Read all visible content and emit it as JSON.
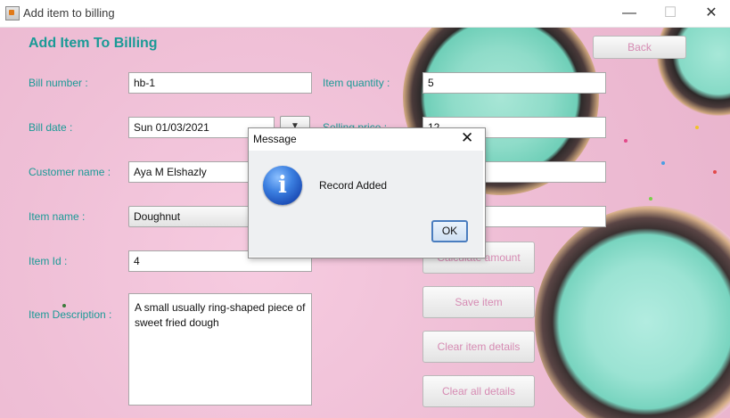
{
  "window": {
    "title": "Add item to billing",
    "controls": {
      "minimize": "—",
      "maximize": "☐",
      "close": "✕"
    }
  },
  "form": {
    "heading": "Add Item To Billing",
    "back_label": "Back",
    "bill_number": {
      "label": "Bill number :",
      "value": "hb-1"
    },
    "bill_date": {
      "label": "Bill date :",
      "value": "Sun 01/03/2021",
      "button": "▼"
    },
    "customer_name": {
      "label": "Customer name :",
      "value": "Aya M Elshazly"
    },
    "item_name": {
      "label": "Item name :",
      "value": "Doughnut"
    },
    "item_id": {
      "label": "Item Id :",
      "value": "4"
    },
    "item_description": {
      "label": "Item Description :",
      "value": "A small usually ring-shaped piece of sweet fried dough"
    },
    "item_quantity": {
      "label": "Item quantity :",
      "value": "5"
    },
    "selling_price": {
      "label": "Selling price :",
      "value": "12"
    },
    "field3": {
      "value": ""
    },
    "field4": {
      "value": ""
    },
    "buttons": {
      "calculate": "Calculate amount",
      "save": "Save item",
      "clear_item": "Clear item details",
      "clear_all": "Clear all details"
    }
  },
  "dialog": {
    "title": "Message",
    "close": "✕",
    "icon": "info-icon",
    "message": "Record Added",
    "ok": "OK"
  },
  "colors": {
    "label": "#1a9a96",
    "button_text": "#d68bb3",
    "background": "#efbfd6"
  }
}
